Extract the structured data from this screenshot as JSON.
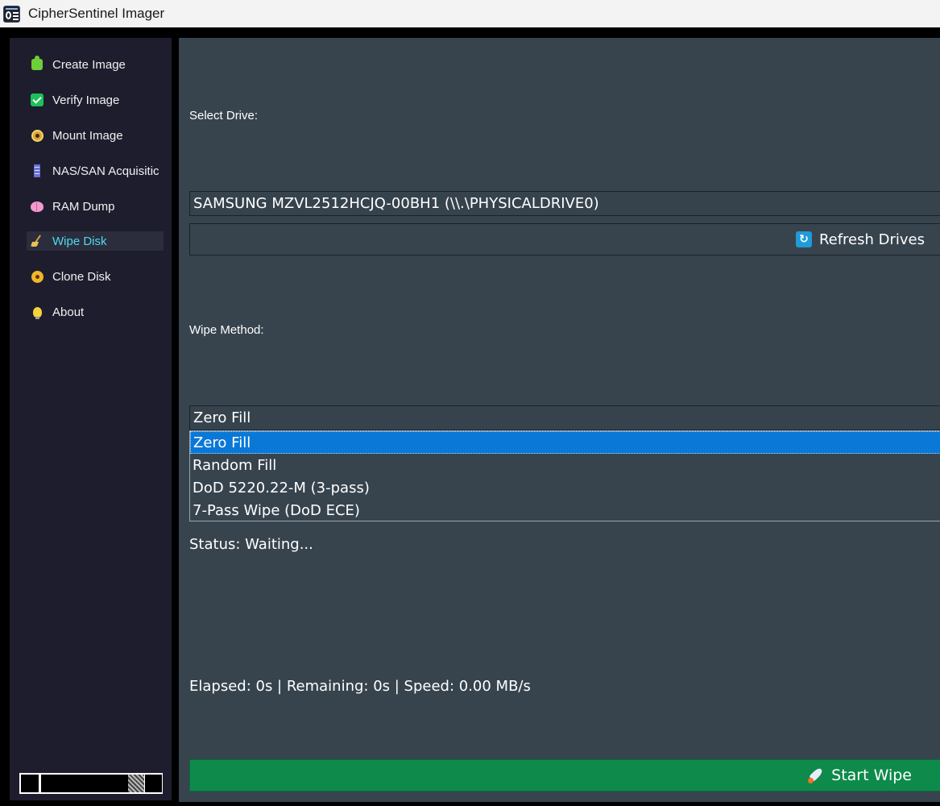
{
  "window": {
    "title": "CipherSentinel Imager"
  },
  "sidebar": {
    "items": [
      {
        "label": "Create Image",
        "icon": "puzzle-icon"
      },
      {
        "label": "Verify Image",
        "icon": "check-icon"
      },
      {
        "label": "Mount Image",
        "icon": "disc-icon"
      },
      {
        "label": "NAS/SAN Acquisitic",
        "icon": "server-icon"
      },
      {
        "label": "RAM Dump",
        "icon": "brain-icon"
      },
      {
        "label": "Wipe Disk",
        "icon": "broom-icon",
        "active": true
      },
      {
        "label": "Clone Disk",
        "icon": "cd-icon"
      },
      {
        "label": "About",
        "icon": "lightbulb-icon"
      }
    ]
  },
  "main": {
    "select_drive_label": "Select Drive:",
    "drive_selected": "SAMSUNG MZVL2512HCJQ-00BH1 (\\\\.\\PHYSICALDRIVE0)",
    "refresh_label": "Refresh Drives",
    "refresh_icon_glyph": "↻",
    "wipe_method_label": "Wipe Method:",
    "wipe_method_selected": "Zero Fill",
    "wipe_methods": [
      "Zero Fill",
      "Random Fill",
      "DoD 5220.22-M (3-pass)",
      "7-Pass Wipe (DoD ECE)"
    ],
    "status": "Status: Waiting...",
    "metrics": "Elapsed: 0s | Remaining: 0s | Speed: 0.00 MB/s",
    "start_label": "Start Wipe"
  },
  "colors": {
    "sidebar_bg": "#1e1d2d",
    "main_bg": "#37444e",
    "active_nav": "#4fd8f0",
    "dropdown_highlight": "#0a78d7",
    "start_button": "#0e8a4a"
  }
}
